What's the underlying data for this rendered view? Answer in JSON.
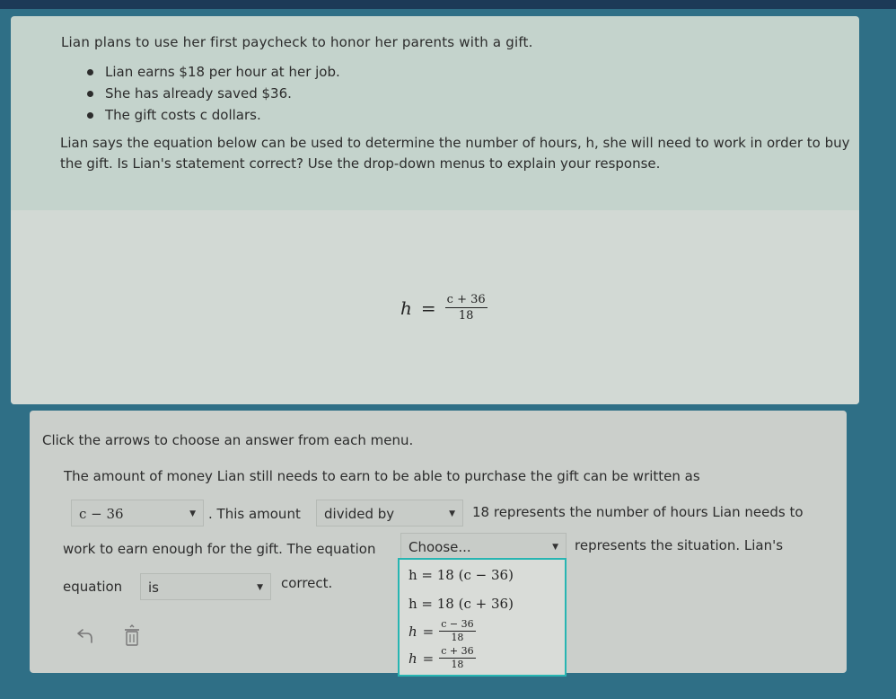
{
  "question": {
    "intro": "Lian plans to use her first paycheck to honor her parents with a gift.",
    "bullets": [
      "Lian earns $18 per hour at her job.",
      "She has already saved $36.",
      "The gift costs c dollars."
    ],
    "prompt": "Lian says the equation below can be used to determine the number of hours, h, she will need to work in order to buy the gift. Is Lian's statement correct? Use the drop-down menus to explain your response.",
    "equation": {
      "lhs": "h",
      "eq": "=",
      "numerator": "c + 36",
      "denominator": "18"
    }
  },
  "answer": {
    "instruction": "Click the arrows to choose an answer from each menu.",
    "line1": "The amount of money Lian still needs to earn to be able to purchase the gift can be written as",
    "dropdown1_value": "c − 36",
    "text_this_amount": ". This amount",
    "dropdown2_value": "divided by",
    "text_represents": "18 represents the number of hours Lian needs to",
    "text_work": "work to earn enough for the gift. The equation",
    "dropdown3_value": "Choose...",
    "text_represents_situation": "represents the situation. Lian's",
    "text_equation": "equation",
    "dropdown4_value": "is",
    "text_correct": "correct.",
    "options": [
      {
        "text": "h = 18 (c − 36)"
      },
      {
        "text": "h = 18 (c + 36)"
      },
      {
        "lhs": "h",
        "eq": "=",
        "numerator": "c − 36",
        "denominator": "18"
      },
      {
        "lhs": "h",
        "eq": "=",
        "numerator": "c + 36",
        "denominator": "18"
      }
    ]
  },
  "icons": {
    "undo": "undo-icon",
    "delete": "trash-icon",
    "dropdown": "caret-down-icon"
  },
  "colors": {
    "background": "#2f6f86",
    "highlight": "#27b5b2",
    "card": "#c4d3cc"
  }
}
